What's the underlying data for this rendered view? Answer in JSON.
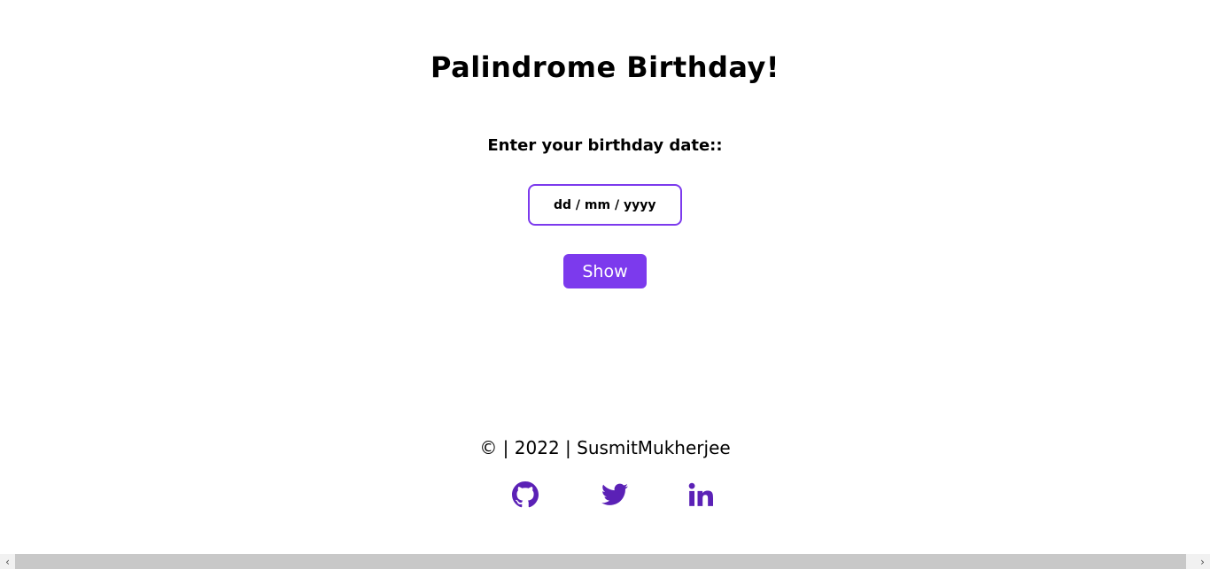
{
  "header": {
    "title": "Palindrome Birthday!"
  },
  "form": {
    "label": "Enter your birthday date::",
    "date_placeholder": "dd / mm / yyyy",
    "show_button": "Show"
  },
  "footer": {
    "text": "© | 2022 | SusmitMukherjee",
    "social_links": [
      {
        "icon": "github-icon"
      },
      {
        "icon": "twitter-icon"
      },
      {
        "icon": "linkedin-icon"
      }
    ]
  },
  "scrollbar": {
    "left_arrow": "‹",
    "right_arrow": "›"
  },
  "colors": {
    "accent": "#7c3aed",
    "icon": "#5b21b6",
    "background": "#ffffff",
    "text": "#000000"
  }
}
